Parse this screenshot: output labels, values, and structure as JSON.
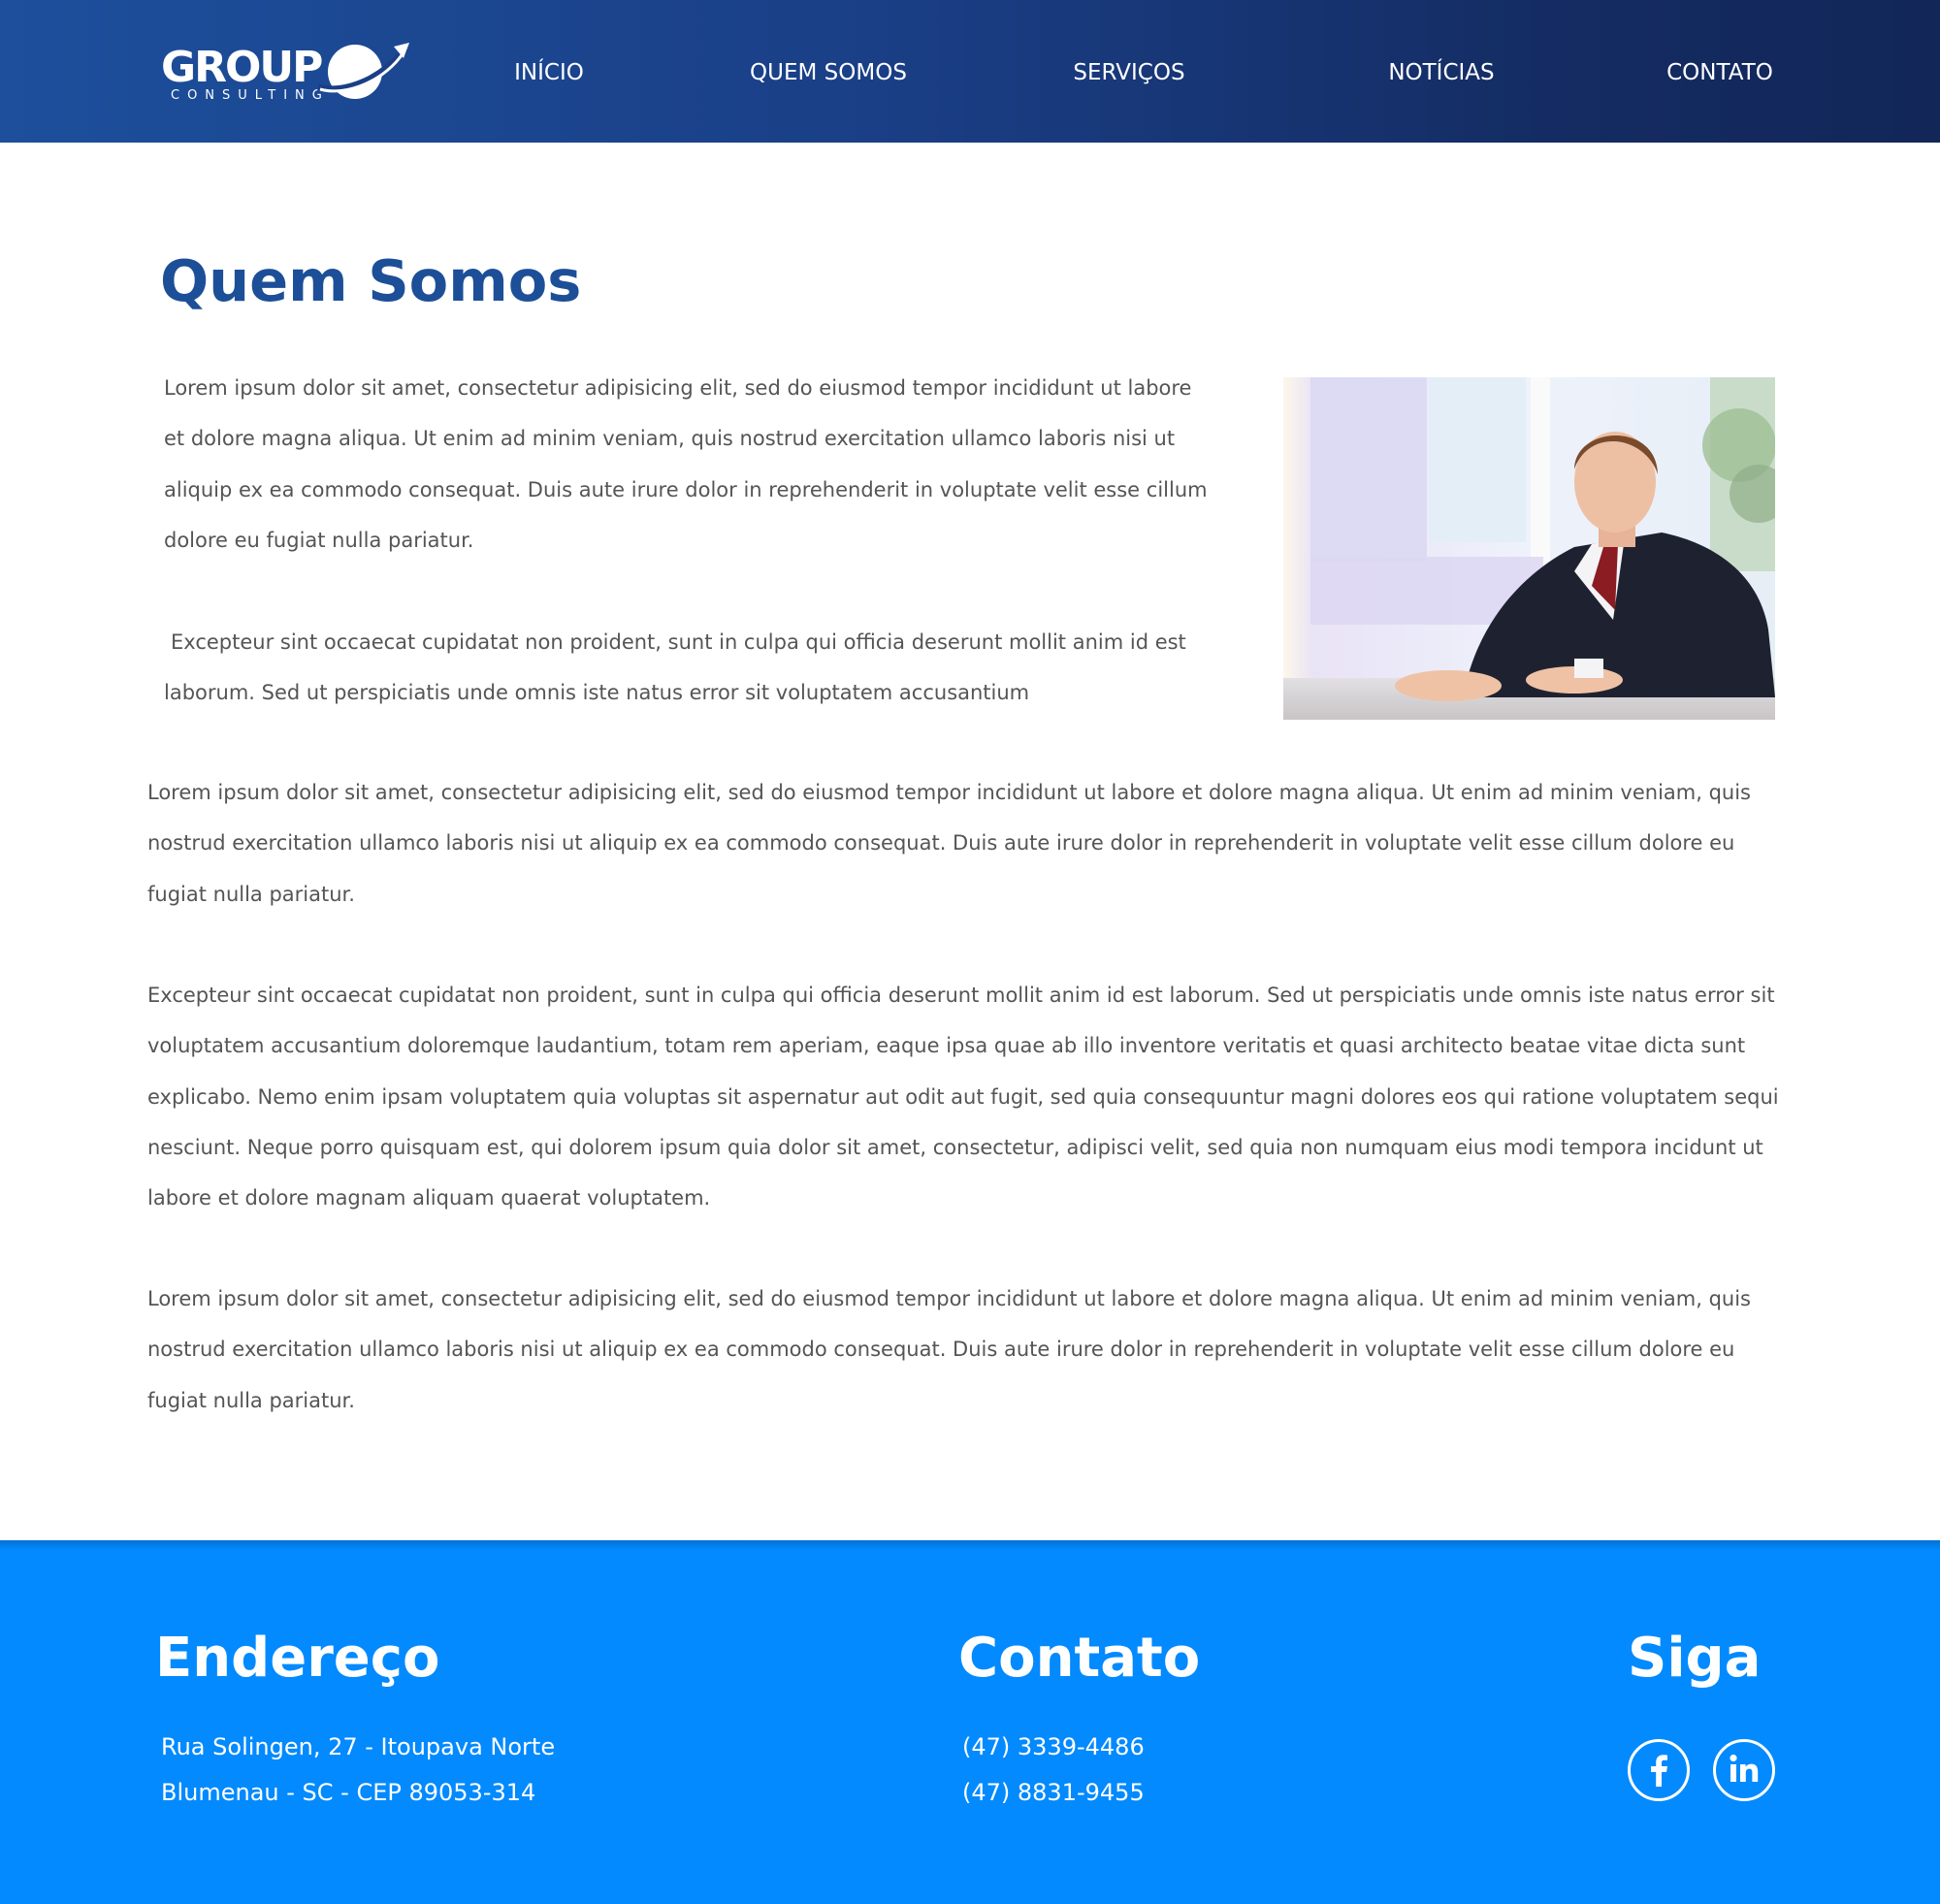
{
  "header": {
    "logo": {
      "word": "GROUP",
      "sub": "CONSULTING"
    },
    "nav": [
      {
        "label": "INÍCIO"
      },
      {
        "label": "QUEM SOMOS"
      },
      {
        "label": "SERVIÇOS"
      },
      {
        "label": "NOTÍCIAS"
      },
      {
        "label": "CONTATO"
      }
    ]
  },
  "main": {
    "title": "Quem Somos",
    "intro_paragraphs": [
      "Lorem ipsum dolor sit amet, consectetur adipisicing elit, sed do eiusmod tempor incididunt ut labore et dolore magna aliqua. Ut enim ad minim veniam, quis nostrud exercitation ullamco laboris nisi ut aliquip ex ea commodo consequat. Duis aute irure dolor in reprehenderit in voluptate velit esse cillum dolore eu fugiat nulla pariatur.",
      "Excepteur sint occaecat cupidatat non proident, sunt in culpa qui officia deserunt mollit anim id est laborum. Sed ut perspiciatis unde omnis iste natus error sit voluptatem accusantium"
    ],
    "body_paragraphs": [
      "Lorem ipsum dolor sit amet, consectetur adipisicing elit, sed do eiusmod tempor incididunt ut labore et dolore magna aliqua. Ut enim ad minim veniam, quis nostrud exercitation ullamco laboris nisi ut aliquip ex ea commodo consequat. Duis aute irure dolor in reprehenderit in voluptate velit esse cillum dolore eu fugiat nulla pariatur.",
      "Excepteur sint occaecat cupidatat non proident, sunt in culpa qui officia deserunt mollit anim id est laborum. Sed ut perspiciatis unde omnis iste natus error sit voluptatem accusantium doloremque laudantium, totam rem aperiam, eaque ipsa quae ab illo inventore veritatis et quasi architecto beatae vitae dicta sunt explicabo. Nemo enim ipsam voluptatem quia voluptas sit aspernatur aut odit aut fugit, sed quia consequuntur magni dolores eos qui ratione voluptatem sequi nesciunt. Neque porro quisquam est, qui dolorem ipsum quia dolor sit amet, consectetur, adipisci velit, sed quia non numquam eius modi tempora incidunt ut labore et dolore magnam aliquam quaerat voluptatem.",
      "Lorem ipsum dolor sit amet, consectetur adipisicing elit, sed do eiusmod tempor incididunt ut labore et dolore magna aliqua. Ut enim ad minim veniam, quis nostrud exercitation ullamco laboris nisi ut aliquip ex ea commodo consequat. Duis aute irure dolor in reprehenderit in voluptate velit esse cillum dolore eu fugiat nulla pariatur."
    ]
  },
  "footer": {
    "address": {
      "heading": "Endereço",
      "lines": [
        "Rua Solingen, 27 - Itoupava Norte",
        "Blumenau - SC - CEP 89053-314"
      ]
    },
    "contact": {
      "heading": "Contato",
      "lines": [
        "(47) 3339-4486",
        "(47) 8831-9455"
      ]
    },
    "social": {
      "heading": "Siga",
      "icons": [
        "facebook-icon",
        "linkedin-icon"
      ]
    }
  },
  "colors": {
    "header_gradient_start": "#1d4f9c",
    "header_gradient_end": "#122658",
    "title": "#1c4f97",
    "body_text": "#555555",
    "footer_bg": "#028afe",
    "footer_text": "#ffffff"
  }
}
